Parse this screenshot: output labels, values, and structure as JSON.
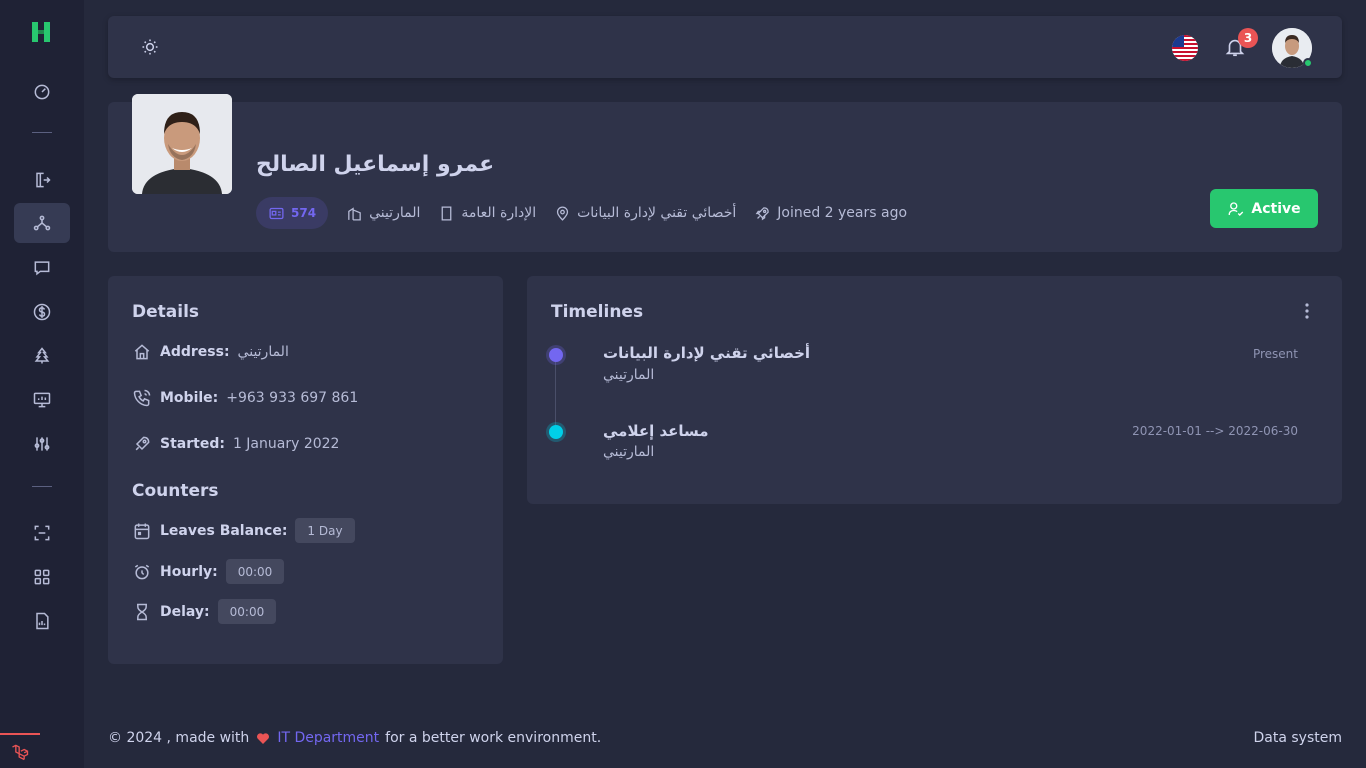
{
  "sidebar": {
    "logo": "H",
    "items": [
      {
        "icon": "dashboard-icon"
      },
      {
        "icon": "logout-door-icon"
      },
      {
        "icon": "network-structure-icon",
        "active": true
      },
      {
        "icon": "chat-icon"
      },
      {
        "icon": "dollar-icon"
      },
      {
        "icon": "tree-icon"
      },
      {
        "icon": "monitor-chart-icon"
      },
      {
        "icon": "sliders-icon"
      },
      {
        "icon": "scan-icon"
      },
      {
        "icon": "grid-icon"
      },
      {
        "icon": "report-icon"
      }
    ]
  },
  "topbar": {
    "notifications_count": "3"
  },
  "profile": {
    "name": "عمرو إسماعيل الصالح",
    "employee_id": "574",
    "branch": "المارتيني",
    "department": "الإدارة العامة",
    "position": "أخصائي تقني لإدارة البيانات",
    "joined": "Joined 2 years ago",
    "status_label": "Active"
  },
  "details": {
    "title": "Details",
    "address_label": "Address:",
    "address_value": "المارتيني",
    "mobile_label": "Mobile:",
    "mobile_value": "+963 933 697 861",
    "started_label": "Started:",
    "started_value": "1 January 2022"
  },
  "counters": {
    "title": "Counters",
    "leaves_label": "Leaves Balance:",
    "leaves_value": "1 Day",
    "hourly_label": "Hourly:",
    "hourly_value": "00:00",
    "delay_label": "Delay:",
    "delay_value": "00:00"
  },
  "timelines": {
    "title": "Timelines",
    "items": [
      {
        "title": "أخصائي تقني لإدارة البيانات",
        "subtitle": "المارتيني",
        "date": "Present",
        "color": "#7367f0"
      },
      {
        "title": "مساعد إعلامي",
        "subtitle": "المارتيني",
        "date": "2022-01-01 --> 2022-06-30",
        "color": "#00cfe8"
      }
    ]
  },
  "footer": {
    "prefix": "© 2024 , made with",
    "link": "IT Department",
    "suffix": "for a better work environment.",
    "right": "Data system"
  },
  "colors": {
    "primary": "#7367f0",
    "success": "#28c76f",
    "danger": "#ea5455",
    "info": "#00cfe8"
  }
}
